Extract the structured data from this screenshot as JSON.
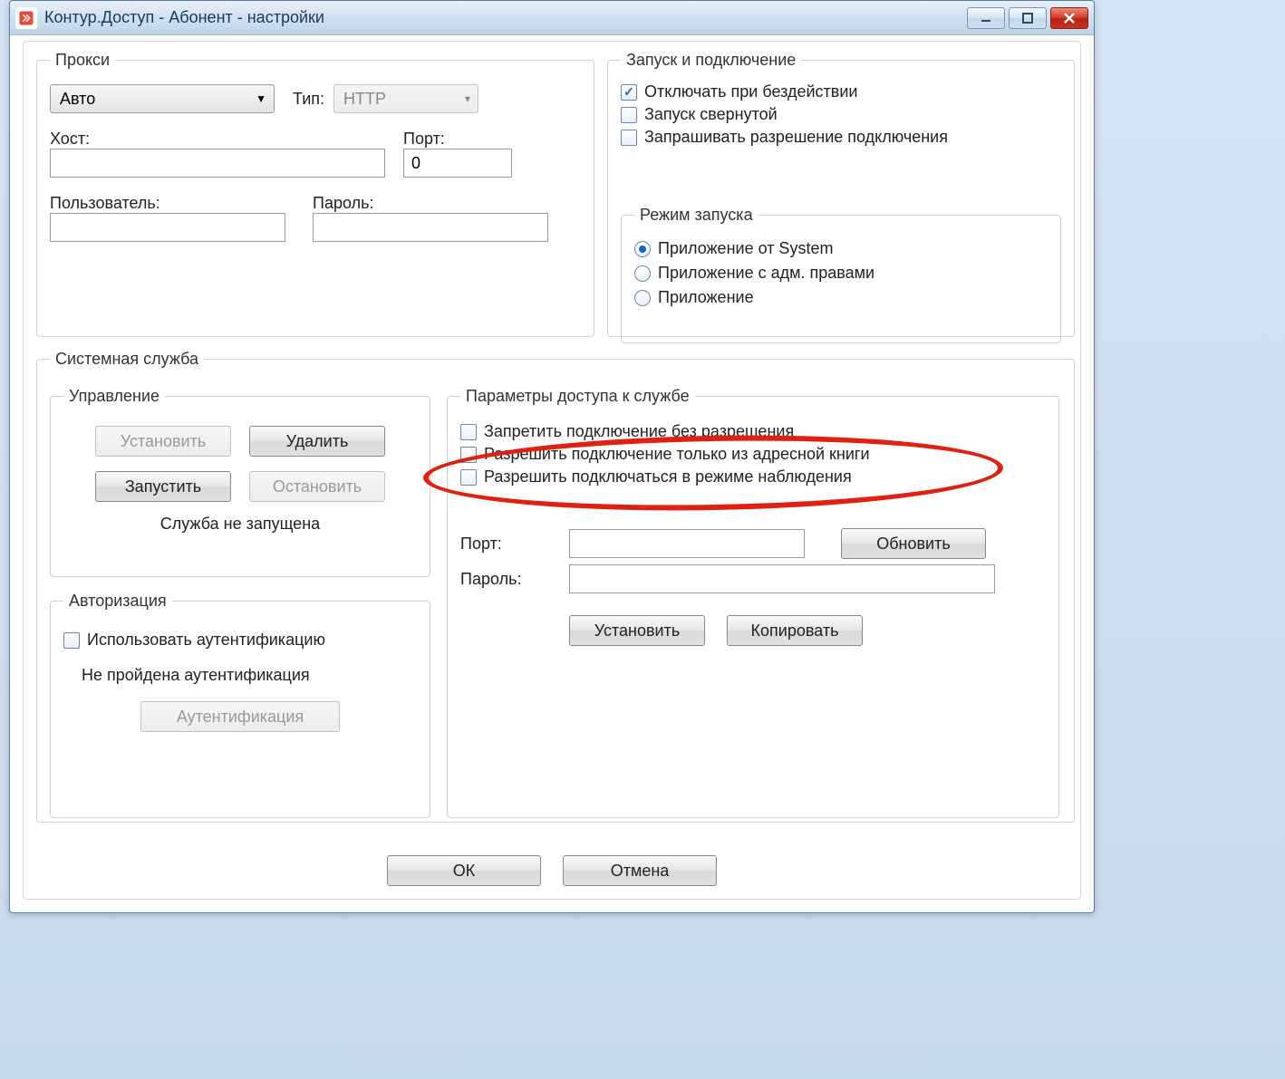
{
  "window": {
    "title": "Контур.Доступ - Абонент - настройки"
  },
  "proxy": {
    "legend": "Прокси",
    "mode_value": "Авто",
    "type_label": "Тип:",
    "type_value": "HTTP",
    "host_label": "Хост:",
    "host_value": "",
    "port_label": "Порт:",
    "port_value": "0",
    "user_label": "Пользователь:",
    "user_value": "",
    "password_label": "Пароль:",
    "password_value": ""
  },
  "startup": {
    "legend": "Запуск и подключение",
    "idle_disconnect": "Отключать при бездействии",
    "idle_disconnect_checked": true,
    "start_minimized": "Запуск свернутой",
    "start_minimized_checked": false,
    "ask_permission": "Запрашивать разрешение подключения",
    "ask_permission_checked": false,
    "launch_mode": {
      "legend": "Режим запуска",
      "options": [
        {
          "label": "Приложение от System",
          "selected": true
        },
        {
          "label": "Приложение с адм. правами",
          "selected": false
        },
        {
          "label": "Приложение",
          "selected": false
        }
      ]
    }
  },
  "service": {
    "legend": "Системная служба",
    "manage": {
      "legend": "Управление",
      "install": "Установить",
      "delete": "Удалить",
      "start": "Запустить",
      "stop": "Остановить",
      "status": "Служба не запущена",
      "install_enabled": false,
      "delete_enabled": true,
      "start_enabled": true,
      "stop_enabled": false
    },
    "auth": {
      "legend": "Авторизация",
      "use_auth": "Использовать аутентификацию",
      "use_auth_checked": false,
      "status": "Не пройдена аутентификация",
      "auth_btn": "Аутентификация",
      "auth_btn_enabled": false
    },
    "access": {
      "legend": "Параметры доступа к службе",
      "forbid_no_perm": "Запретить подключение без разрешения",
      "forbid_no_perm_checked": false,
      "only_address_book": "Разрешить подключение только из адресной книги",
      "only_address_book_checked": false,
      "allow_observe": "Разрешить подключаться в режиме наблюдения",
      "allow_observe_checked": false,
      "port_label": "Порт:",
      "port_value": "",
      "refresh_btn": "Обновить",
      "password_label": "Пароль:",
      "password_value": "",
      "set_btn": "Установить",
      "copy_btn": "Копировать"
    }
  },
  "footer": {
    "ok": "ОК",
    "cancel": "Отмена"
  }
}
